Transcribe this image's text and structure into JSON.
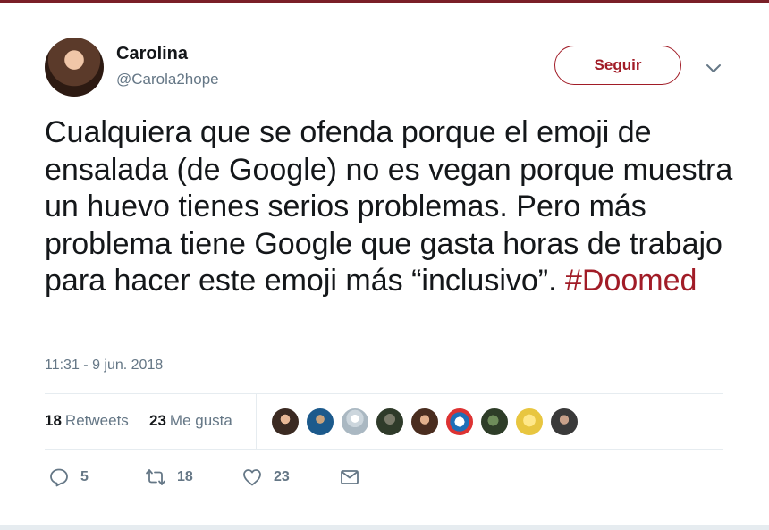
{
  "user": {
    "display_name": "Carolina",
    "handle": "@Carola2hope",
    "follow_label": "Seguir"
  },
  "tweet": {
    "text": "Cualquiera que se ofenda porque el emoji de ensalada (de Google) no es vegan porque muestra un huevo tienes serios problemas. Pero más problema tiene Google que gasta horas de trabajo para hacer este emoji más “inclusivo”.",
    "hashtag": "#Doomed",
    "timestamp": "11:31 - 9 jun. 2018"
  },
  "stats": {
    "retweets_count": "18",
    "retweets_label": "Retweets",
    "likes_count": "23",
    "likes_label": "Me gusta"
  },
  "actions": {
    "reply_count": "5",
    "retweet_count": "18",
    "like_count": "23"
  },
  "colors": {
    "accent": "#a11c27",
    "text": "#14171a",
    "muted": "#657786",
    "divider": "#e6ecf0"
  },
  "icons": [
    "reply-icon",
    "retweet-icon",
    "heart-icon",
    "mail-icon",
    "chevron-down-icon"
  ]
}
